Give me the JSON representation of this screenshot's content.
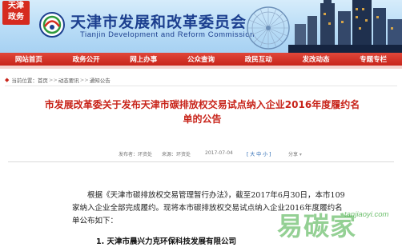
{
  "banner": {
    "seal_text": "天津\n政务",
    "title": "天津市发展和改革委员会",
    "subtitle": "Tianjin Development and Reform Commission"
  },
  "nav": {
    "items": [
      "网站首页",
      "政务公开",
      "网上办事",
      "公众查询",
      "政民互动",
      "发改动态",
      "专题专栏"
    ]
  },
  "breadcrumb": {
    "prefix": "当前位置：",
    "items": [
      "首页",
      "动态要讯",
      "通知公告"
    ],
    "separator": ">>"
  },
  "article": {
    "title": "市发展改革委关于发布天津市碳排放权交易试点纳入企业2016年度履约名单的公告",
    "meta": {
      "publisher": "发布者：环资处",
      "source": "来源：环资处",
      "date": "2017-07-04",
      "font_size_label": "[ 大 中 小 ]",
      "share_label": "分享"
    },
    "paragraph": "根据《天津市碳排放权交易管理暂行办法》，截至2017年6月30日，本市109家纳入企业全部完成履约。现将本市碳排放权交易试点纳入企业2016年度履约名单公布如下：",
    "first_item": "1. 天津市晨兴力克环保科技发展有限公司"
  },
  "watermark": {
    "cn": "易碳家",
    "en": "tanjiaoyi.com"
  },
  "colors": {
    "nav_red": "#c8241a",
    "title_blue": "#1c3f8f",
    "article_title_red": "#c8241a",
    "watermark_green": "#3caa3c"
  }
}
